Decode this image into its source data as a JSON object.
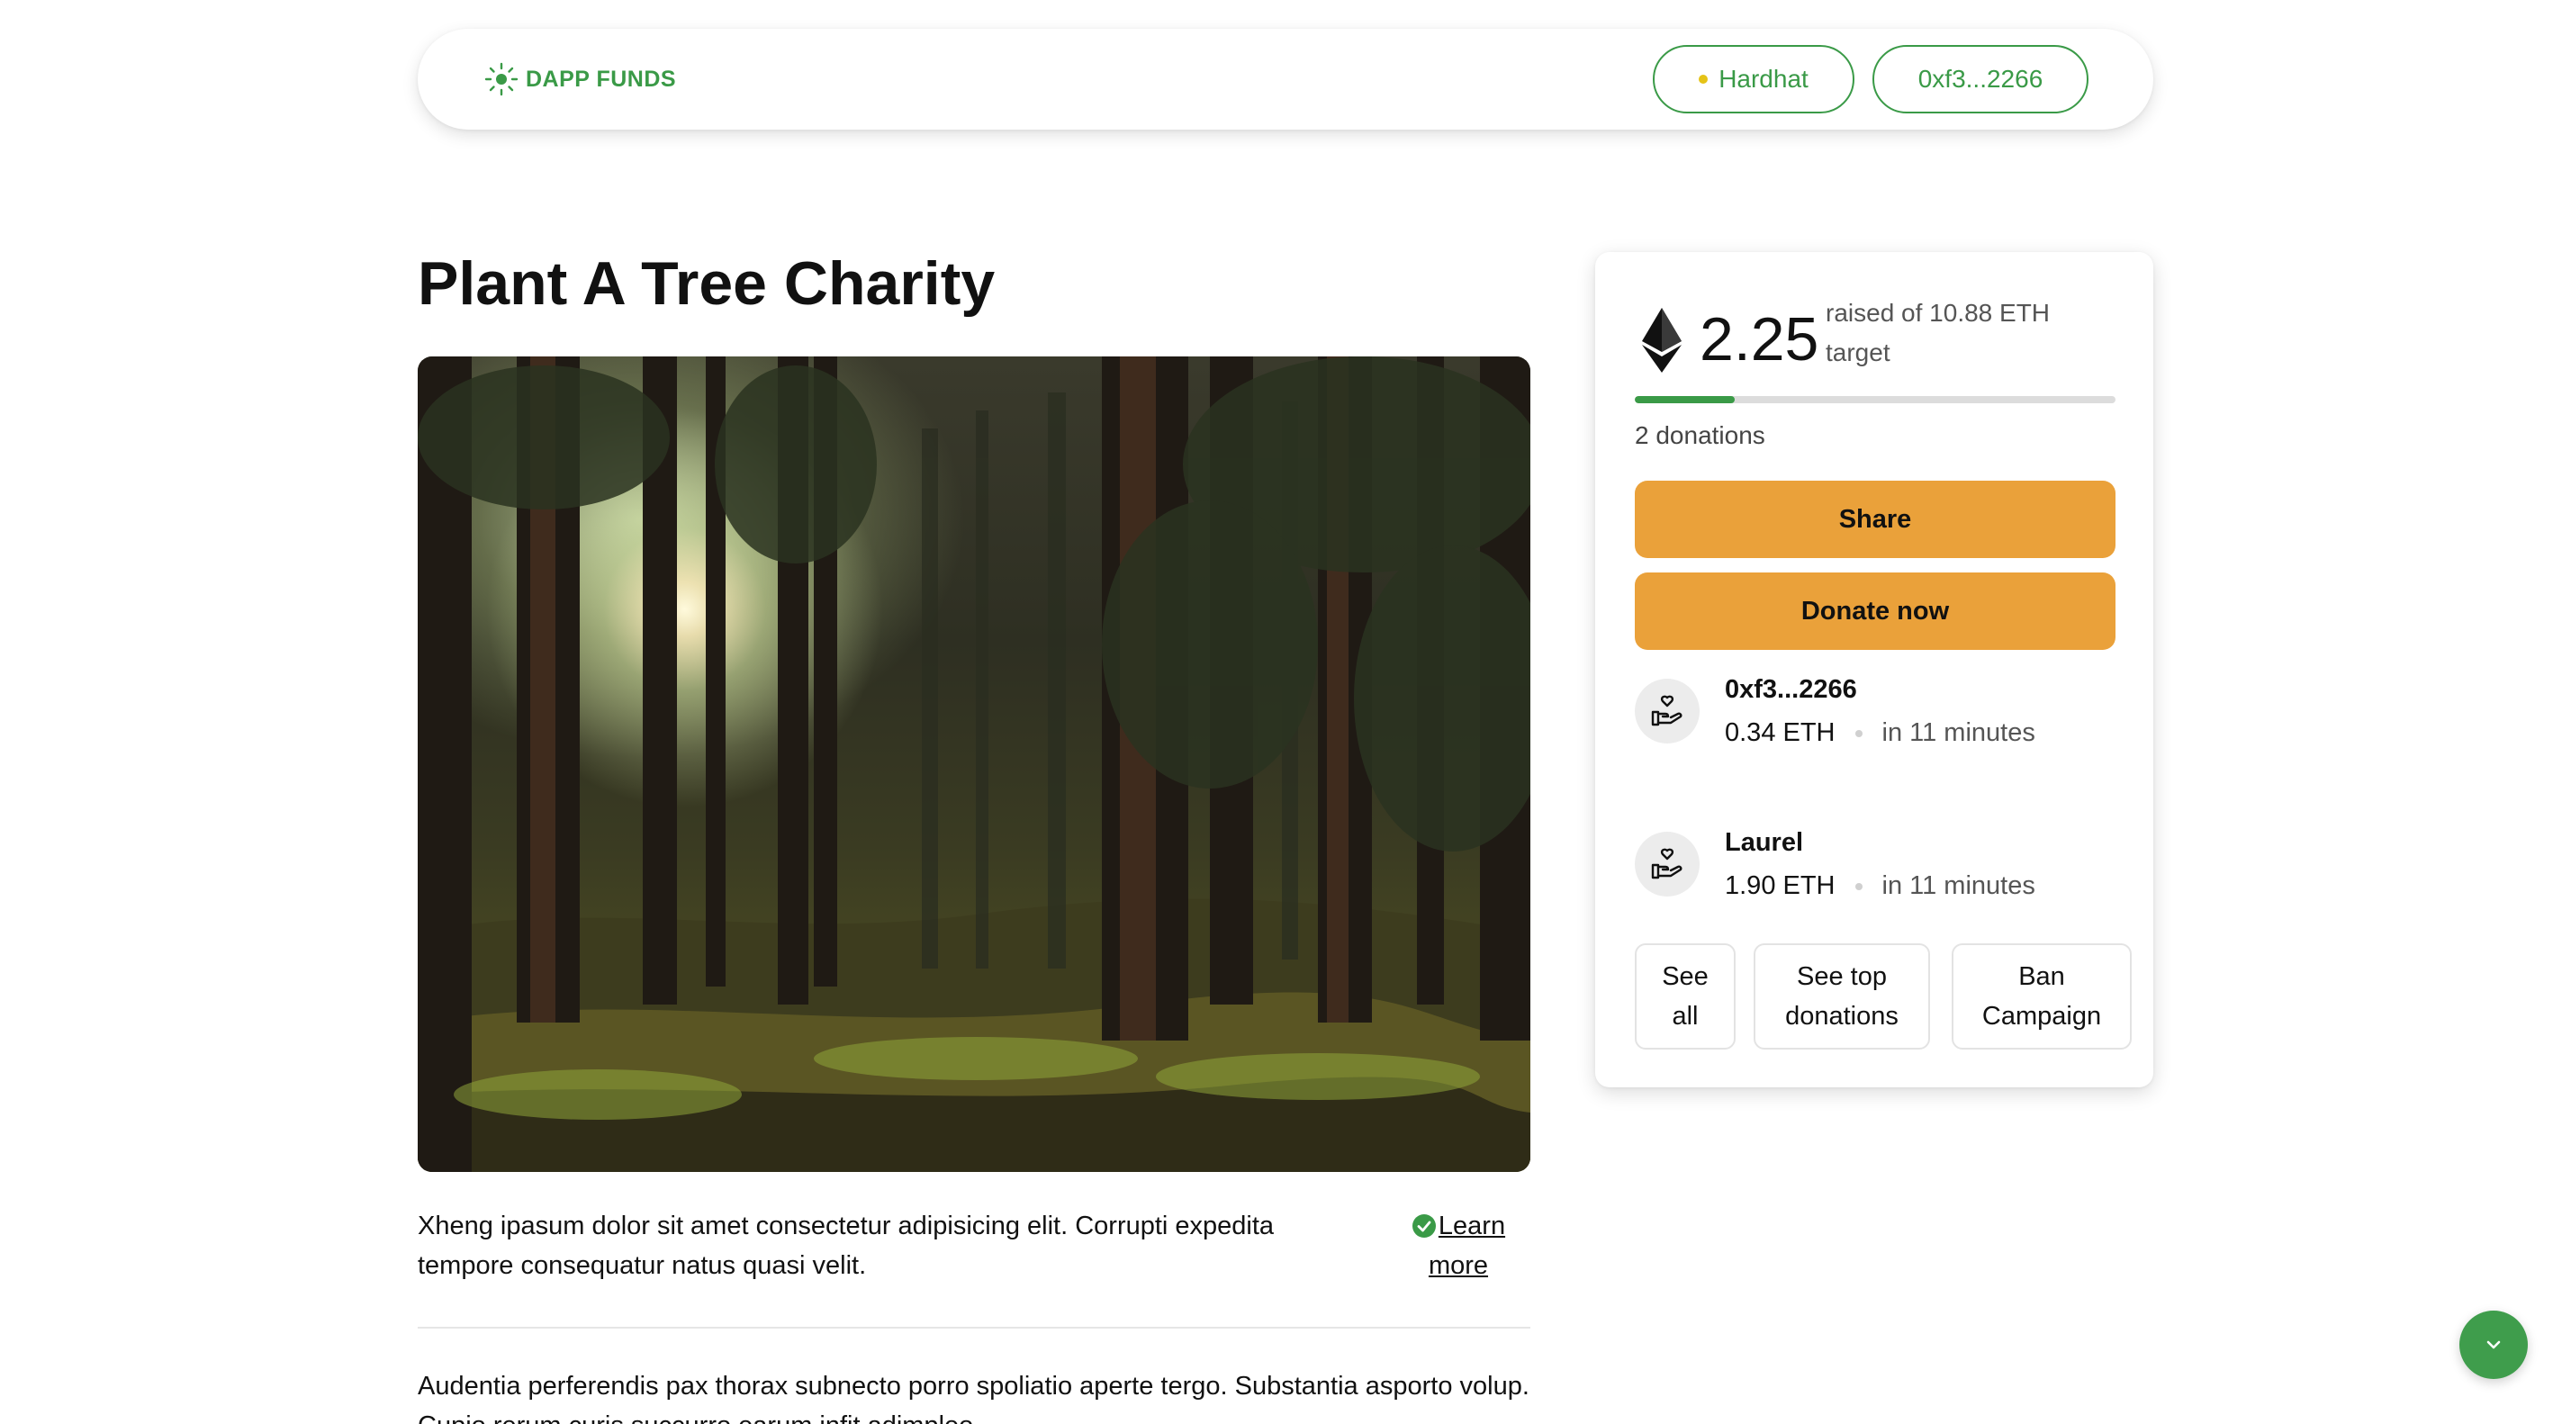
{
  "header": {
    "logo_text": "DAPP FUNDS",
    "network_label": "Hardhat",
    "account_label": "0xf3...2266",
    "accent_color": "#3a9a47"
  },
  "campaign": {
    "title": "Plant A Tree Charity",
    "description_short": "Xheng ipasum dolor sit amet consectetur adipisicing elit. Corrupti expedita tempore consequatur natus quasi velit.",
    "learn_more_line1": "Learn",
    "learn_more_line2": "more",
    "description_long": "Audentia perferendis pax thorax subnecto porro spoliatio aperte tergo. Substantia asporto volup. Cupio rerum curis succurro earum infit adimpleo."
  },
  "funding": {
    "raised": "2.25",
    "raised_of_text": "raised of 10.88 ETH target",
    "progress_fraction": 0.207,
    "donations_count_text": "2 donations",
    "share_label": "Share",
    "donate_label": "Donate now",
    "button_color": "#eaa13a"
  },
  "donations": [
    {
      "donor": "0xf3...2266",
      "amount": "0.34 ETH",
      "time": "in 11 minutes",
      "icon": "hand-donate-icon"
    },
    {
      "donor": "Laurel",
      "amount": "1.90 ETH",
      "time": "in 11 minutes",
      "icon": "hand-donate-icon"
    }
  ],
  "actions": {
    "see_all_line1": "See",
    "see_all_line2": "all",
    "see_top_line1": "See top",
    "see_top_line2": "donations",
    "ban_line1": "Ban",
    "ban_line2": "Campaign"
  },
  "icons": {
    "logo": "sun-icon",
    "network": "status-dot-icon",
    "eth": "ethereum-icon",
    "check": "check-circle-icon",
    "fab": "chevron-down-icon"
  }
}
